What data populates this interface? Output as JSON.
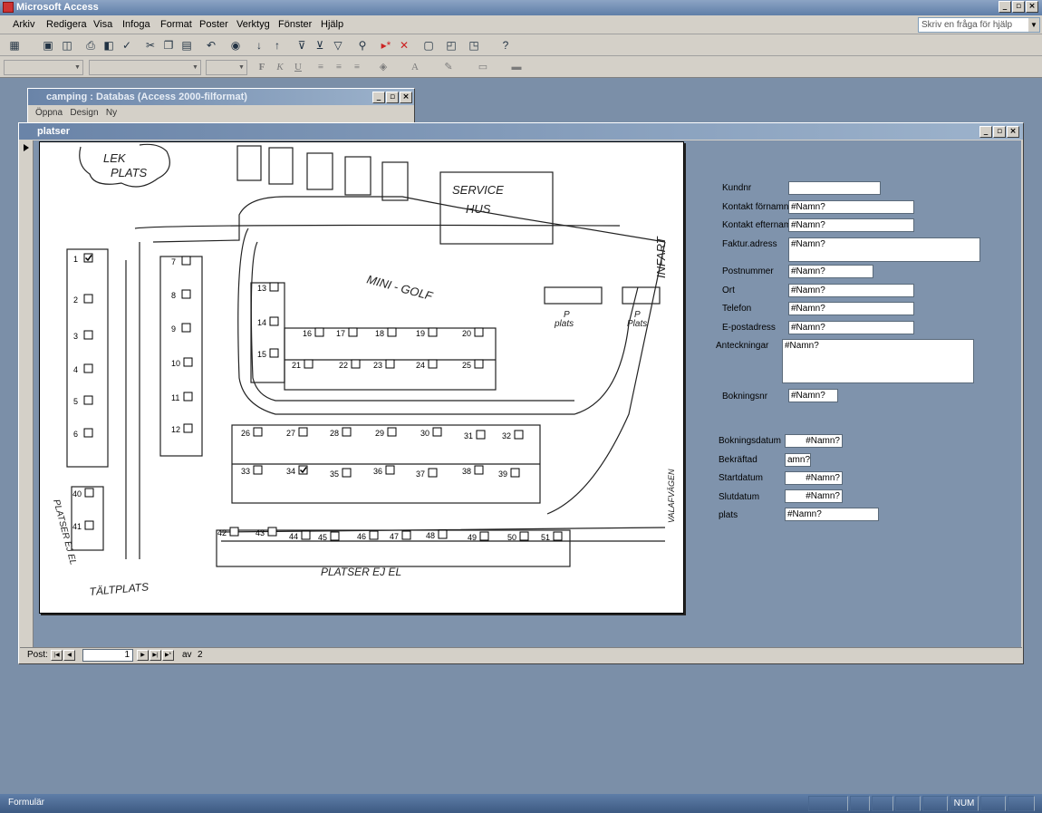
{
  "app": {
    "title": "Microsoft Access"
  },
  "menu": [
    "Arkiv",
    "Redigera",
    "Visa",
    "Infoga",
    "Format",
    "Poster",
    "Verktyg",
    "Fönster",
    "Hjälp"
  ],
  "help": {
    "placeholder": "Skriv en fråga för hjälp"
  },
  "db_window": {
    "title": "camping : Databas (Access 2000-filformat)",
    "tools": [
      "Öppna",
      "Design",
      "Ny"
    ]
  },
  "form_window": {
    "title": "platser"
  },
  "map": {
    "texts": {
      "lek1": "LEK",
      "lek2": "PLATS",
      "service1": "SERVICE",
      "service2": "HUS",
      "minigolf": "MINI - GOLF",
      "infart": "INFART",
      "p1": "P",
      "plats1": "plats",
      "p2": "P",
      "plats2": "Plats",
      "platser_ej_el": "PLATSER EJ EL",
      "platser_ej_el_left": "PLATSER EJ EL",
      "taltplats": "TÄLTPLATS",
      "vagen": "VALAFVÄGEN"
    },
    "checked_sites": [
      "1",
      "34"
    ]
  },
  "form": {
    "labels": {
      "kundnr": "Kundnr",
      "fornamn": "Kontakt förnamn",
      "efternamn": "Kontakt efternamn",
      "adress": "Faktur.adress",
      "postnummer": "Postnummer",
      "ort": "Ort",
      "telefon": "Telefon",
      "epost": "E-postadress",
      "anteckningar": "Anteckningar",
      "bokningsnr": "Bokningsnr",
      "bokningsdatum": "Bokningsdatum",
      "bekraftad": "Bekräftad",
      "startdatum": "Startdatum",
      "slutdatum": "Slutdatum",
      "plats": "plats"
    },
    "values": {
      "kundnr": "",
      "fornamn": "#Namn?",
      "efternamn": "#Namn?",
      "adress": "#Namn?",
      "postnummer": "#Namn?",
      "ort": "#Namn?",
      "telefon": "#Namn?",
      "epost": "#Namn?",
      "anteckningar": "#Namn?",
      "bokningsnr": "#Namn?",
      "bokningsdatum": "#Namn?",
      "bekraftad": "amn?",
      "startdatum": "#Namn?",
      "slutdatum": "#Namn?",
      "plats": "#Namn?"
    }
  },
  "record_nav": {
    "label": "Post:",
    "current": "1",
    "of_label": "av",
    "total": "2"
  },
  "status": {
    "mode": "Formulär",
    "num": "NUM"
  },
  "colors": {
    "titlebar": "#5f7ea8",
    "formbg": "#7f93ac",
    "desktop": "#7b8fa8"
  }
}
